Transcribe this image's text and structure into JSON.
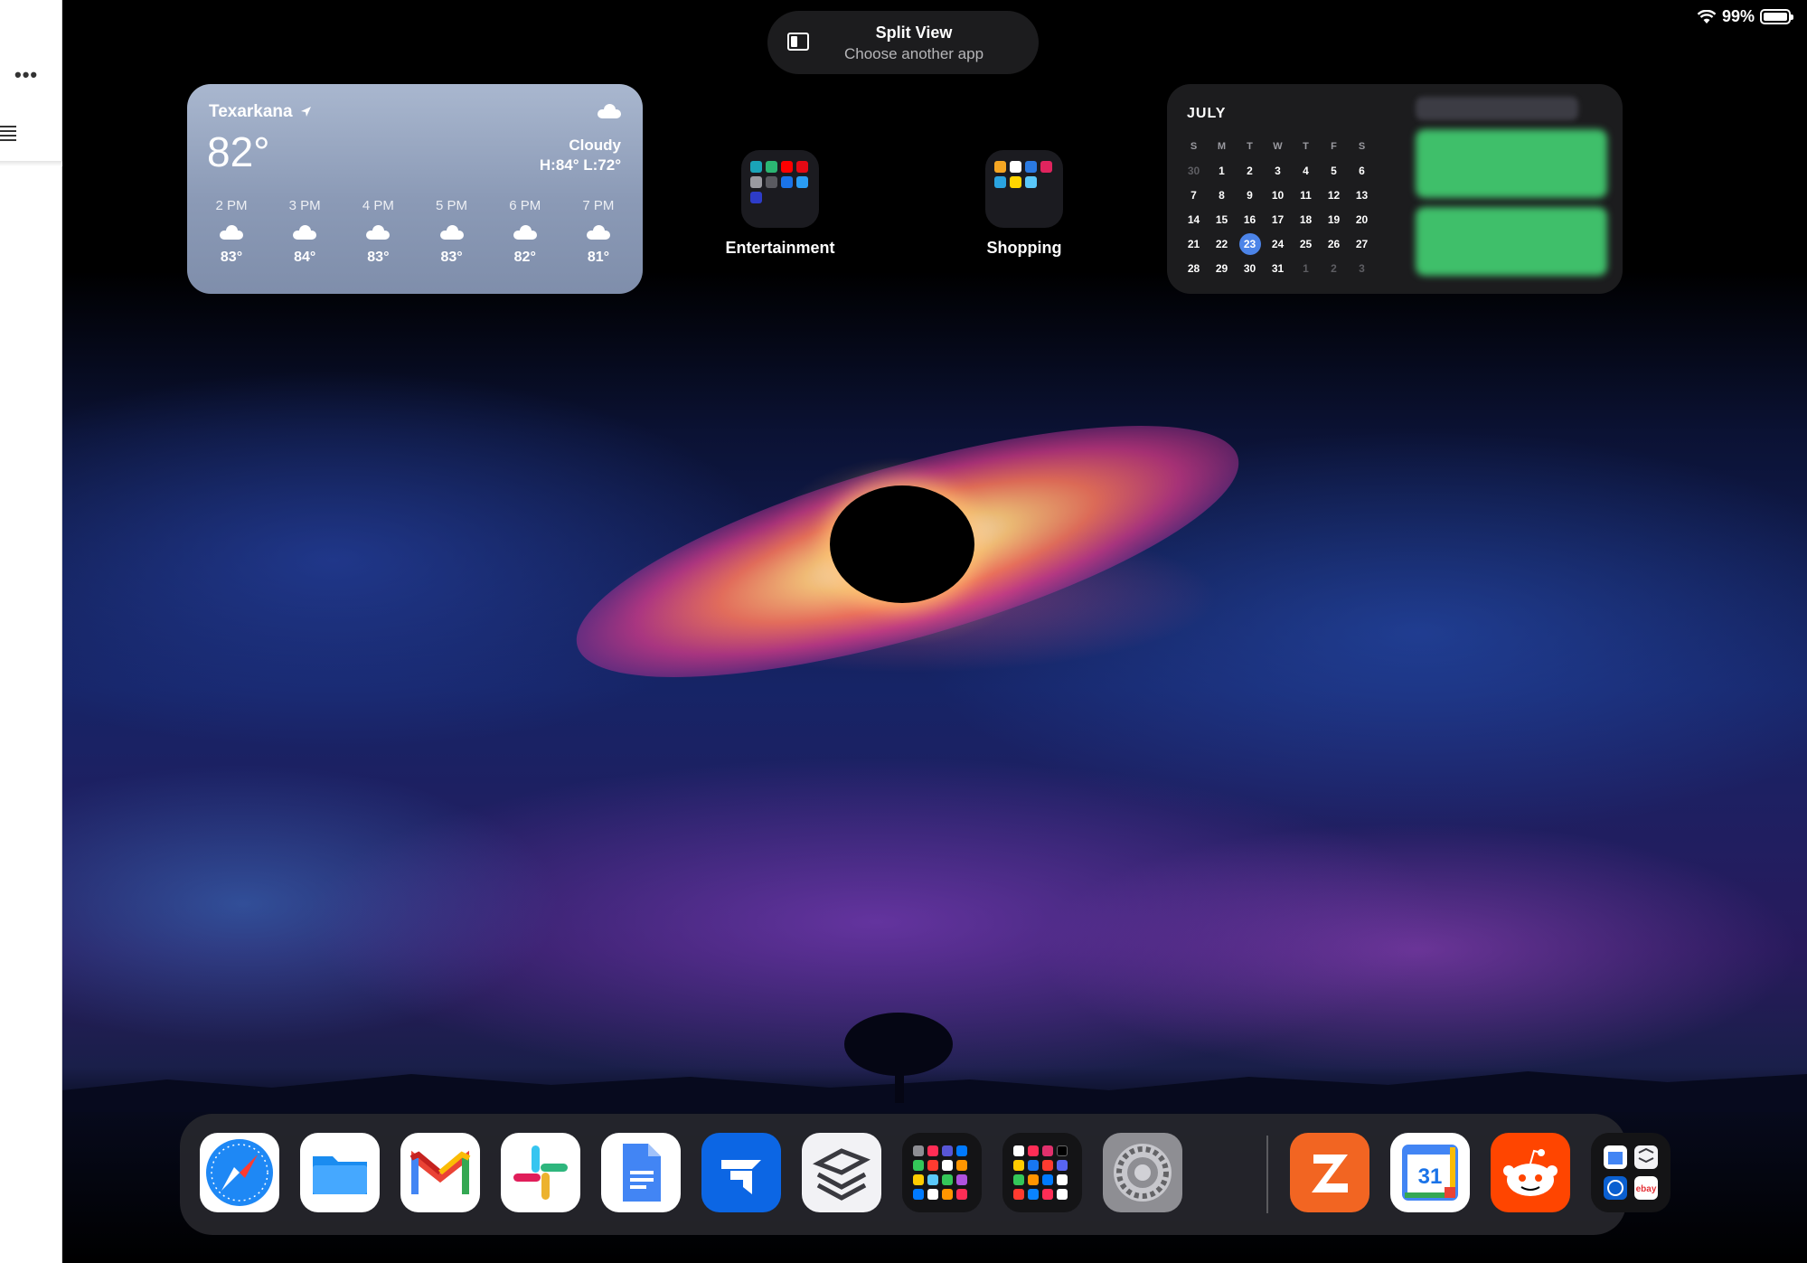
{
  "status_bar": {
    "battery": "99%"
  },
  "split_view": {
    "title": "Split View",
    "subtitle": "Choose another app"
  },
  "weather": {
    "city": "Texarkana",
    "temperature": "82°",
    "condition": "Cloudy",
    "high_low": "H:84° L:72°",
    "hours": [
      {
        "time": "2 PM",
        "temp": "83°"
      },
      {
        "time": "3 PM",
        "temp": "84°"
      },
      {
        "time": "4 PM",
        "temp": "83°"
      },
      {
        "time": "5 PM",
        "temp": "83°"
      },
      {
        "time": "6 PM",
        "temp": "82°"
      },
      {
        "time": "7 PM",
        "temp": "81°"
      }
    ]
  },
  "folders": [
    {
      "label": "Entertainment"
    },
    {
      "label": "Shopping"
    }
  ],
  "calendar": {
    "month": "JULY",
    "weekdays": [
      "S",
      "M",
      "T",
      "W",
      "T",
      "F",
      "S"
    ],
    "weeks": [
      [
        "30",
        "1",
        "2",
        "3",
        "4",
        "5",
        "6"
      ],
      [
        "7",
        "8",
        "9",
        "10",
        "11",
        "12",
        "13"
      ],
      [
        "14",
        "15",
        "16",
        "17",
        "18",
        "19",
        "20"
      ],
      [
        "21",
        "22",
        "23",
        "24",
        "25",
        "26",
        "27"
      ],
      [
        "28",
        "29",
        "30",
        "31",
        "1",
        "2",
        "3"
      ]
    ],
    "today": "23"
  },
  "dock_apps": [
    {
      "name": "safari-icon",
      "color": "#1e88f5"
    },
    {
      "name": "files-icon",
      "color": "#1a8cf0"
    },
    {
      "name": "gmail-icon",
      "color": "#ea4335"
    },
    {
      "name": "slack-icon",
      "color": "#4a154b"
    },
    {
      "name": "google-docs-icon",
      "color": "#4285f4"
    },
    {
      "name": "jira-icon",
      "color": "#0052cc"
    },
    {
      "name": "todoist-icon",
      "color": "#e9e9ef"
    },
    {
      "name": "app-library-folder-icon",
      "color": "#141416"
    },
    {
      "name": "social-folder-icon",
      "color": "#141416"
    },
    {
      "name": "settings-icon",
      "color": "#8e8e93"
    },
    {
      "name": "zoho-icon",
      "color": "#f26522"
    },
    {
      "name": "google-calendar-icon",
      "color": "#4285f4"
    },
    {
      "name": "reddit-icon",
      "color": "#ff4500"
    },
    {
      "name": "recent-apps-icon",
      "color": "#141416"
    }
  ],
  "calendar_date_31": "31",
  "ebay_label": "ebay"
}
